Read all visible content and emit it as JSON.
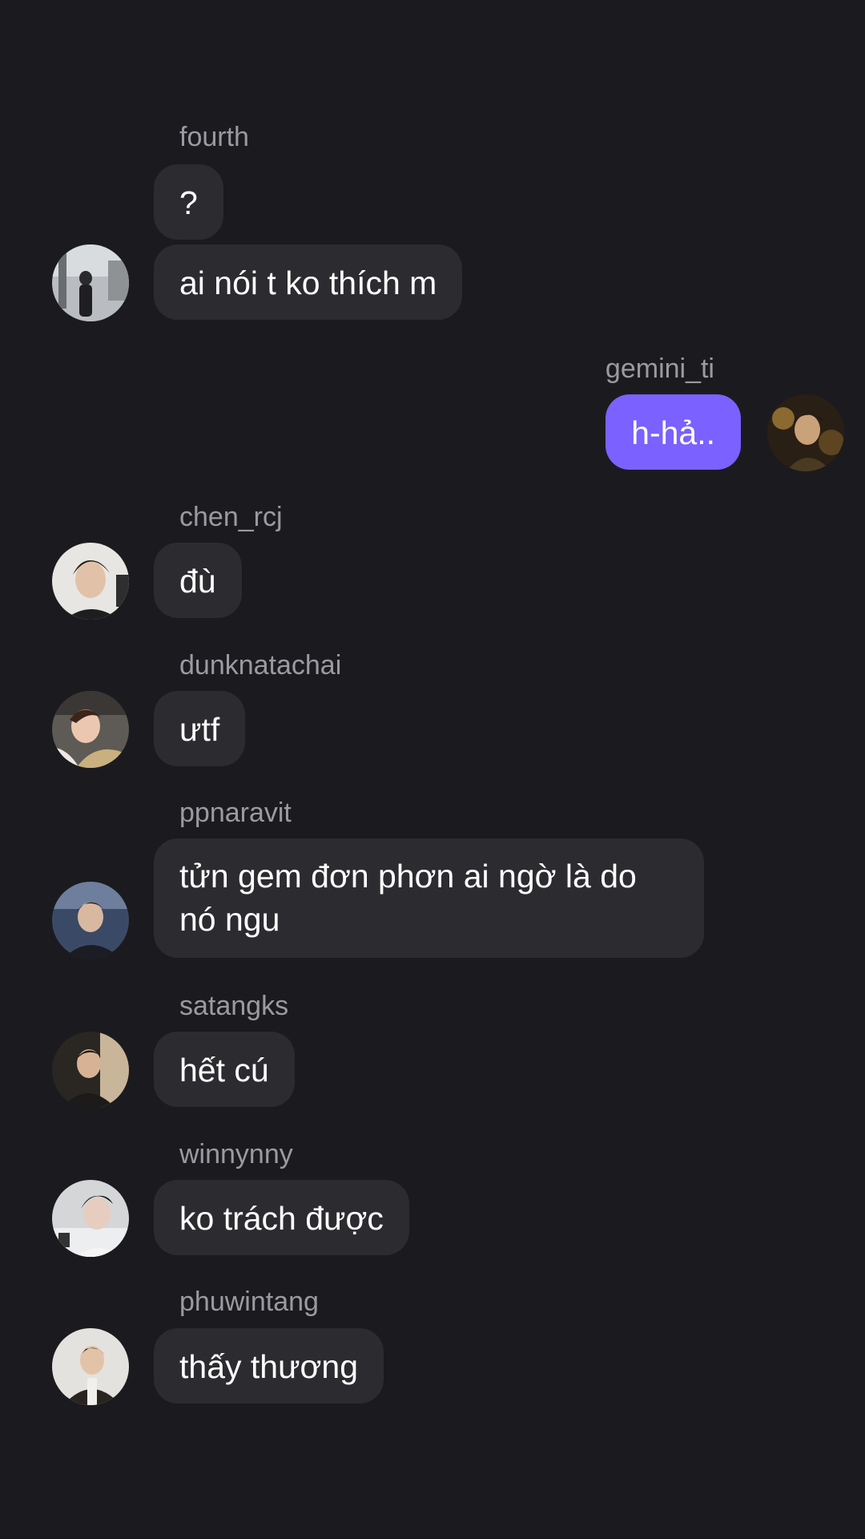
{
  "messages": [
    {
      "sender": "fourth",
      "texts": [
        "?",
        "ai nói t ko thích m"
      ]
    },
    {
      "sender": "gemini_ti",
      "texts": [
        "h-hả.."
      ],
      "mine": true
    },
    {
      "sender": "chen_rcj",
      "texts": [
        "đù"
      ]
    },
    {
      "sender": "dunknatachai",
      "texts": [
        "ưtf"
      ]
    },
    {
      "sender": "ppnaravit",
      "texts": [
        "tửn gem đơn phơn ai ngờ là do nó ngu"
      ]
    },
    {
      "sender": "satangks",
      "texts": [
        "hết cú"
      ]
    },
    {
      "sender": "winnynny",
      "texts": [
        "ko trách được"
      ]
    },
    {
      "sender": "phuwintang",
      "texts": [
        "thấy thương"
      ]
    }
  ],
  "colors": {
    "background": "#1b1b1f",
    "bubble_other": "#2c2c30",
    "bubble_mine": "#7b61ff",
    "sender_text": "#9a9aa0"
  }
}
